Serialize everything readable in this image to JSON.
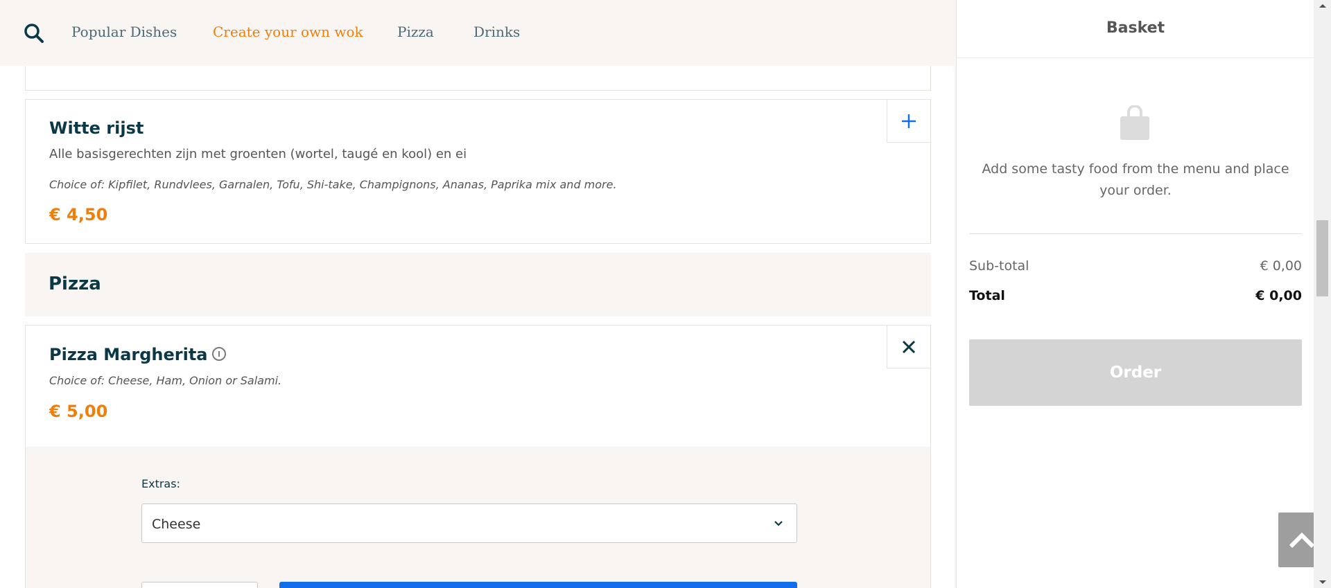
{
  "nav": {
    "items": [
      {
        "label": "Popular Dishes",
        "active": false
      },
      {
        "label": "Create your own wok",
        "active": true
      },
      {
        "label": "Pizza",
        "active": false
      },
      {
        "label": "Drinks",
        "active": false
      }
    ],
    "search_icon": "search-icon"
  },
  "dishes": {
    "witte_rijst": {
      "title": "Witte rijst",
      "description": "Alle basisgerechten zijn met groenten (wortel, taugé en kool) en ei",
      "choice": "Choice of: Kipfilet, Rundvlees, Garnalen, Tofu, Shi-take, Champignons, Ananas, Paprika mix and more.",
      "price": "€ 4,50",
      "action_icon": "plus-icon"
    },
    "pizza_section": {
      "title": "Pizza"
    },
    "pizza_margherita": {
      "title": "Pizza Margherita",
      "choice": "Choice of: Cheese, Ham, Onion or Salami.",
      "price": "€ 5,00",
      "action_icon": "close-icon",
      "extras_label": "Extras:",
      "extras_selected": "Cheese"
    }
  },
  "basket": {
    "title": "Basket",
    "empty_message": "Add some tasty food from the menu and place your order.",
    "subtotal_label": "Sub-total",
    "subtotal_value": "€ 0,00",
    "total_label": "Total",
    "total_value": "€ 0,00",
    "order_label": "Order"
  },
  "colors": {
    "accent": "#f07f0a",
    "primary_text": "#0a3847",
    "button_blue": "#126ee8",
    "section_bg": "#f8f5f2",
    "order_disabled": "#d4d4d4"
  }
}
